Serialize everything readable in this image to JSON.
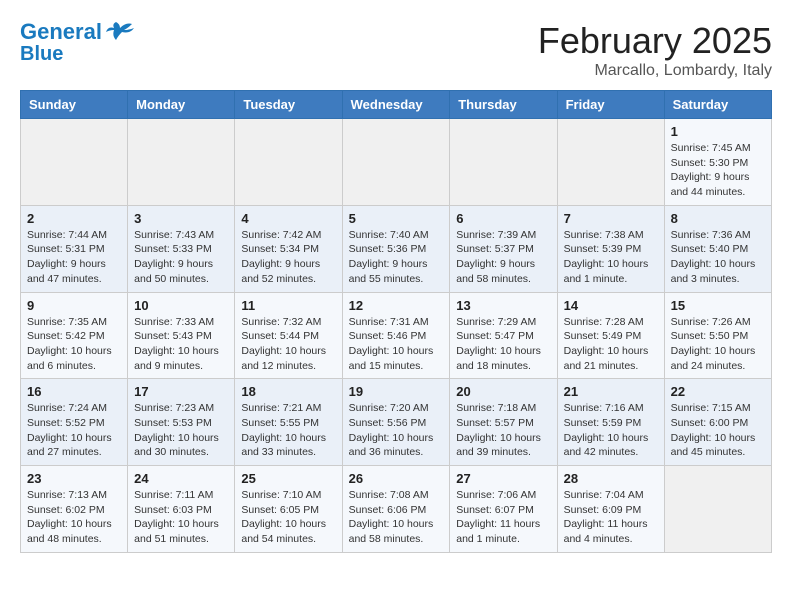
{
  "header": {
    "logo_line1": "General",
    "logo_line2": "Blue",
    "title": "February 2025",
    "subtitle": "Marcallo, Lombardy, Italy"
  },
  "weekdays": [
    "Sunday",
    "Monday",
    "Tuesday",
    "Wednesday",
    "Thursday",
    "Friday",
    "Saturday"
  ],
  "weeks": [
    [
      {
        "day": "",
        "detail": ""
      },
      {
        "day": "",
        "detail": ""
      },
      {
        "day": "",
        "detail": ""
      },
      {
        "day": "",
        "detail": ""
      },
      {
        "day": "",
        "detail": ""
      },
      {
        "day": "",
        "detail": ""
      },
      {
        "day": "1",
        "detail": "Sunrise: 7:45 AM\nSunset: 5:30 PM\nDaylight: 9 hours and 44 minutes."
      }
    ],
    [
      {
        "day": "2",
        "detail": "Sunrise: 7:44 AM\nSunset: 5:31 PM\nDaylight: 9 hours and 47 minutes."
      },
      {
        "day": "3",
        "detail": "Sunrise: 7:43 AM\nSunset: 5:33 PM\nDaylight: 9 hours and 50 minutes."
      },
      {
        "day": "4",
        "detail": "Sunrise: 7:42 AM\nSunset: 5:34 PM\nDaylight: 9 hours and 52 minutes."
      },
      {
        "day": "5",
        "detail": "Sunrise: 7:40 AM\nSunset: 5:36 PM\nDaylight: 9 hours and 55 minutes."
      },
      {
        "day": "6",
        "detail": "Sunrise: 7:39 AM\nSunset: 5:37 PM\nDaylight: 9 hours and 58 minutes."
      },
      {
        "day": "7",
        "detail": "Sunrise: 7:38 AM\nSunset: 5:39 PM\nDaylight: 10 hours and 1 minute."
      },
      {
        "day": "8",
        "detail": "Sunrise: 7:36 AM\nSunset: 5:40 PM\nDaylight: 10 hours and 3 minutes."
      }
    ],
    [
      {
        "day": "9",
        "detail": "Sunrise: 7:35 AM\nSunset: 5:42 PM\nDaylight: 10 hours and 6 minutes."
      },
      {
        "day": "10",
        "detail": "Sunrise: 7:33 AM\nSunset: 5:43 PM\nDaylight: 10 hours and 9 minutes."
      },
      {
        "day": "11",
        "detail": "Sunrise: 7:32 AM\nSunset: 5:44 PM\nDaylight: 10 hours and 12 minutes."
      },
      {
        "day": "12",
        "detail": "Sunrise: 7:31 AM\nSunset: 5:46 PM\nDaylight: 10 hours and 15 minutes."
      },
      {
        "day": "13",
        "detail": "Sunrise: 7:29 AM\nSunset: 5:47 PM\nDaylight: 10 hours and 18 minutes."
      },
      {
        "day": "14",
        "detail": "Sunrise: 7:28 AM\nSunset: 5:49 PM\nDaylight: 10 hours and 21 minutes."
      },
      {
        "day": "15",
        "detail": "Sunrise: 7:26 AM\nSunset: 5:50 PM\nDaylight: 10 hours and 24 minutes."
      }
    ],
    [
      {
        "day": "16",
        "detail": "Sunrise: 7:24 AM\nSunset: 5:52 PM\nDaylight: 10 hours and 27 minutes."
      },
      {
        "day": "17",
        "detail": "Sunrise: 7:23 AM\nSunset: 5:53 PM\nDaylight: 10 hours and 30 minutes."
      },
      {
        "day": "18",
        "detail": "Sunrise: 7:21 AM\nSunset: 5:55 PM\nDaylight: 10 hours and 33 minutes."
      },
      {
        "day": "19",
        "detail": "Sunrise: 7:20 AM\nSunset: 5:56 PM\nDaylight: 10 hours and 36 minutes."
      },
      {
        "day": "20",
        "detail": "Sunrise: 7:18 AM\nSunset: 5:57 PM\nDaylight: 10 hours and 39 minutes."
      },
      {
        "day": "21",
        "detail": "Sunrise: 7:16 AM\nSunset: 5:59 PM\nDaylight: 10 hours and 42 minutes."
      },
      {
        "day": "22",
        "detail": "Sunrise: 7:15 AM\nSunset: 6:00 PM\nDaylight: 10 hours and 45 minutes."
      }
    ],
    [
      {
        "day": "23",
        "detail": "Sunrise: 7:13 AM\nSunset: 6:02 PM\nDaylight: 10 hours and 48 minutes."
      },
      {
        "day": "24",
        "detail": "Sunrise: 7:11 AM\nSunset: 6:03 PM\nDaylight: 10 hours and 51 minutes."
      },
      {
        "day": "25",
        "detail": "Sunrise: 7:10 AM\nSunset: 6:05 PM\nDaylight: 10 hours and 54 minutes."
      },
      {
        "day": "26",
        "detail": "Sunrise: 7:08 AM\nSunset: 6:06 PM\nDaylight: 10 hours and 58 minutes."
      },
      {
        "day": "27",
        "detail": "Sunrise: 7:06 AM\nSunset: 6:07 PM\nDaylight: 11 hours and 1 minute."
      },
      {
        "day": "28",
        "detail": "Sunrise: 7:04 AM\nSunset: 6:09 PM\nDaylight: 11 hours and 4 minutes."
      },
      {
        "day": "",
        "detail": ""
      }
    ]
  ]
}
